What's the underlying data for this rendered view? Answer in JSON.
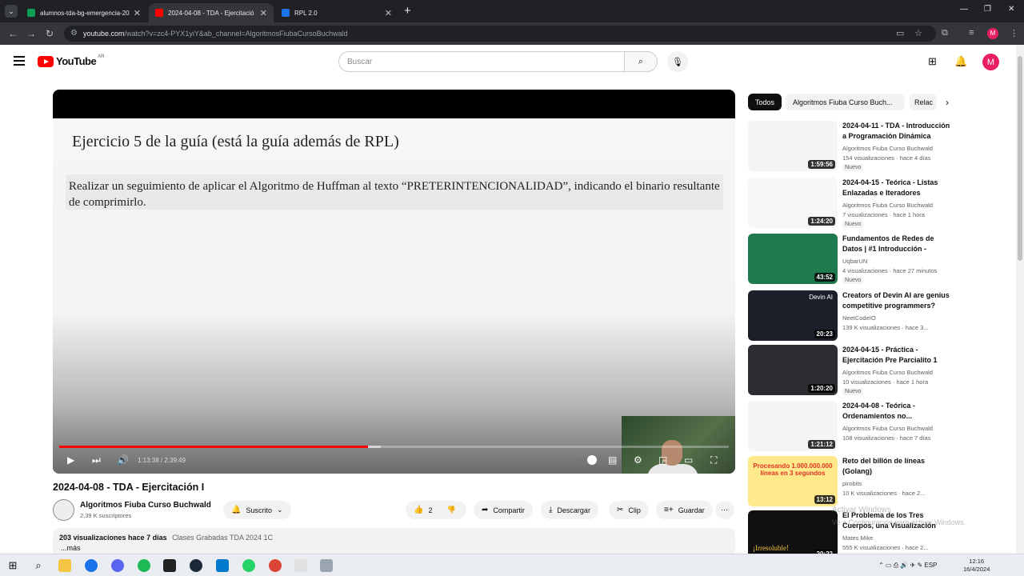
{
  "browser": {
    "tabs": [
      {
        "title": "alumnos-tda-bg-emergencia-20",
        "favicon_color": "#0f9d58",
        "active": false
      },
      {
        "title": "2024-04-08 - TDA - Ejercitació",
        "favicon_color": "#ff0000",
        "active": true
      },
      {
        "title": "RPL 2.0",
        "favicon_color": "#1a73e8",
        "active": false
      }
    ],
    "url_host": "youtube.com",
    "url_path": "/watch?v=zc4-PYX1yiY&ab_channel=AlgoritmosFiubaCursoBuchwald"
  },
  "youtube": {
    "logo_text": "YouTube",
    "country": "AR",
    "search_placeholder": "Buscar",
    "avatar_letter": "M"
  },
  "player": {
    "slide_title": "Ejercicio 5 de la guía (está la guía además de RPL)",
    "slide_text": "Realizar un seguimiento de aplicar el Algoritmo de Huffman al texto “PRETERINTENCIONALIDAD”, indicando el binario resultante de comprimirlo.",
    "time": "1:13:38 / 2:39:49",
    "progress_fraction": 0.461
  },
  "video": {
    "title": "2024-04-08 - TDA - Ejercitación I",
    "channel": "Algoritmos Fiuba Curso Buchwald",
    "subscribers": "2,39 K suscriptores",
    "subscribed_label": "Suscrito",
    "likes": "2",
    "share_label": "Compartir",
    "download_label": "Descargar",
    "clip_label": "Clip",
    "save_label": "Guardar",
    "desc_stats": "203 visualizaciones  hace 7 días",
    "desc_tags": "Clases Grabadas TDA 2024 1C",
    "desc_more": "...más"
  },
  "chips": [
    "Todos",
    "Algoritmos Fiuba Curso Buch...",
    "Relac"
  ],
  "recommendations": [
    {
      "title": "2024-04-11 - TDA - Introducción a Programación Dinámica",
      "channel": "Algoritmos Fiuba Curso Buchwald",
      "meta": "154 visualizaciones  ·  hace 4 días",
      "badge": "Nuevo",
      "duration": "1:59:56",
      "bg": "#f4f4f4"
    },
    {
      "title": "2024-04-15 - Teórica - Listas Enlazadas e Iteradores Externos",
      "channel": "Algoritmos Fiuba Curso Buchwald",
      "meta": "7 visualizaciones  ·  hace 1 hora",
      "badge": "Nuevo",
      "duration": "1:24:20",
      "bg": "#f7f7f7"
    },
    {
      "title": "Fundamentos de Redes de Datos | #1 Introducción - Ósca...",
      "channel": "UqbarUN",
      "meta": "4 visualizaciones  ·  hace 27 minutos",
      "badge": "Nuevo",
      "duration": "43:52",
      "bg": "#1f7a4d"
    },
    {
      "title": "Creators of Devin AI are genius competitive programmers?",
      "channel": "NeetCodeIO",
      "meta": "139 K visualizaciones  ·  hace 3...",
      "badge": "",
      "duration": "20:23",
      "bg": "#1b1f2a"
    },
    {
      "title": "2024-04-15 - Práctica - Ejercitación Pre Parcialito 1",
      "channel": "Algoritmos Fiuba Curso Buchwald",
      "meta": "10 visualizaciones  ·  hace 1 hora",
      "badge": "Nuevo",
      "duration": "1:20:20",
      "bg": "#2b2d31"
    },
    {
      "title": "2024-04-08 - Teórica - Ordenamientos no...",
      "channel": "Algoritmos Fiuba Curso Buchwald",
      "meta": "108 visualizaciones  ·  hace 7 días",
      "badge": "",
      "duration": "1:21:12",
      "bg": "#f5f5f5"
    },
    {
      "title": "Reto del billón de líneas (Golang)",
      "channel": "pirobits",
      "meta": "10 K visualizaciones  ·  hace 2...",
      "badge": "",
      "duration": "13:12",
      "bg": "#ffe98a"
    },
    {
      "title": "El Problema de los Tres Cuerpos, una Visualización del...",
      "channel": "Mates Mike",
      "meta": "555 K visualizaciones  ·  hace 2...",
      "badge": "",
      "duration": "20:22",
      "bg": "#101010"
    }
  ],
  "thumb_overlays": {
    "golang_text": "Procesando 1.000.000.000 líneas en 3 segundos",
    "three_body_text": "¡Irresoluble!",
    "devin_text": "Devin AI"
  },
  "watermark": {
    "line1": "Activar Windows",
    "line2": "Ve a Configuración para activar Windows."
  },
  "taskbar": {
    "lang": "ESP",
    "time": "12:16",
    "date": "16/4/2024"
  }
}
